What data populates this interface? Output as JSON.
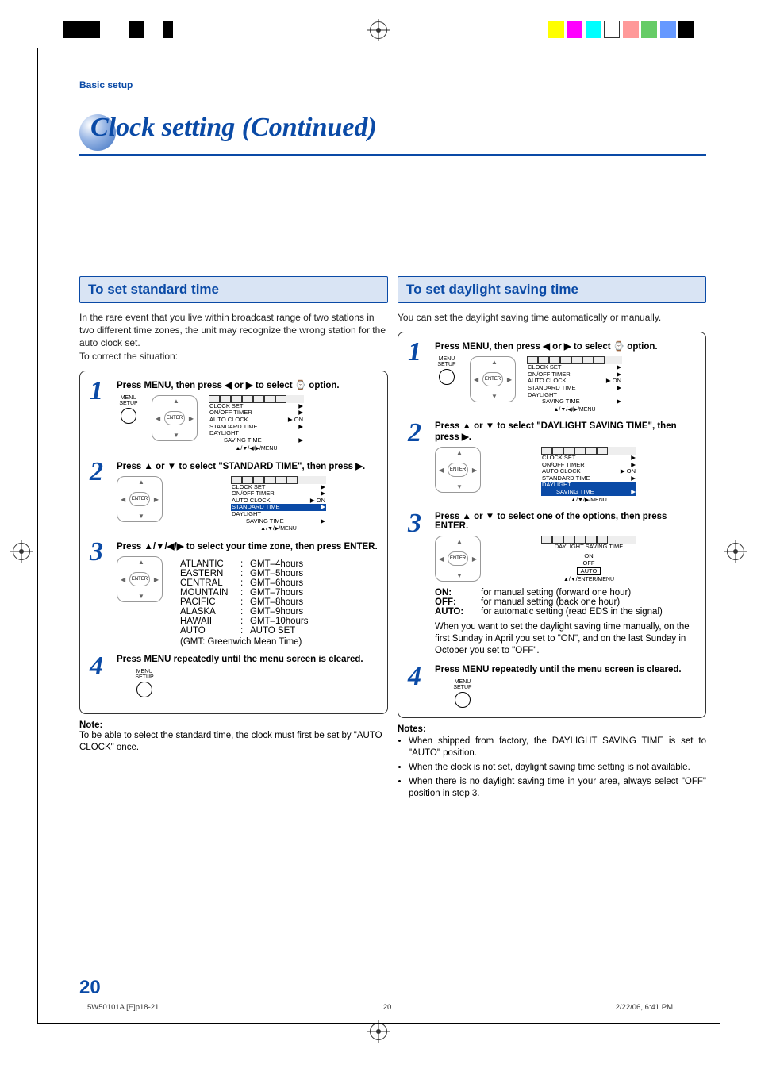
{
  "breadcrumb": "Basic setup",
  "title": "Clock setting (Continued)",
  "left": {
    "heading": "To set standard time",
    "intro": "In the rare event that you live within broadcast range of two stations in two different time zones, the unit may recognize the wrong station for the auto clock set.\nTo correct the situation:",
    "steps": {
      "s1": {
        "num": "1",
        "text_a": "Press MENU, then press ◀ or ▶ to select ",
        "text_b": " option."
      },
      "s2": {
        "num": "2",
        "text_a": "Press ▲ or ▼ to select \"STANDARD TIME\", then press ▶."
      },
      "s3": {
        "num": "3",
        "text_a": "Press ▲/▼/◀/▶ to select your time zone, then press ENTER."
      },
      "s4": {
        "num": "4",
        "text_a": "Press MENU repeatedly until the menu screen is cleared."
      }
    },
    "tz": {
      "rows": [
        {
          "k": "ATLANTIC",
          "v": "GMT–4hours"
        },
        {
          "k": "EASTERN",
          "v": "GMT–5hours"
        },
        {
          "k": "CENTRAL",
          "v": "GMT–6hours"
        },
        {
          "k": "MOUNTAIN",
          "v": "GMT–7hours"
        },
        {
          "k": "PACIFIC",
          "v": "GMT–8hours"
        },
        {
          "k": "ALASKA",
          "v": "GMT–9hours"
        },
        {
          "k": "HAWAII",
          "v": "GMT–10hours"
        },
        {
          "k": "AUTO",
          "v": "AUTO SET"
        }
      ],
      "foot": "(GMT: Greenwich Mean Time)"
    },
    "note_h": "Note:",
    "note_b": "To be able to select the standard time, the clock must first be set by \"AUTO CLOCK\" once."
  },
  "right": {
    "heading": "To set daylight saving time",
    "intro": "You can set the daylight saving time automatically or manually.",
    "steps": {
      "s1": {
        "num": "1",
        "text_a": "Press MENU, then press ◀ or ▶ to select ",
        "text_b": " option."
      },
      "s2": {
        "num": "2",
        "text_a": "Press ▲ or ▼ to select \"DAYLIGHT SAVING TIME\", then press ▶."
      },
      "s3": {
        "num": "3",
        "text_a": "Press ▲ or ▼ to select one of the options, then press ENTER."
      },
      "s4": {
        "num": "4",
        "text_a": "Press MENU repeatedly until the menu screen is cleared."
      }
    },
    "opts": {
      "on": {
        "k": "ON:",
        "v": "for manual setting (forward one hour)"
      },
      "off": {
        "k": "OFF:",
        "v": "for manual setting (back one hour)"
      },
      "auto": {
        "k": "AUTO:",
        "v": "for automatic setting (read EDS in the signal)"
      },
      "para": "When you want to set the daylight saving time manually, on the first Sunday in April you set to \"ON\", and on the last Sunday in October you set to \"OFF\"."
    },
    "notes_h": "Notes:",
    "notes": [
      "When shipped from factory, the DAYLIGHT SAVING TIME is set to \"AUTO\" position.",
      "When the clock is not set, daylight saving time setting is not available.",
      "When there is no daylight saving time in your area, always select \"OFF\" position in step 3."
    ]
  },
  "osd": {
    "cap1": "▲/▼/◀/▶/MENU",
    "cap2": "▲/▼/▶/MENU",
    "cap3": "▲/▼/ENTER/MENU",
    "lines": {
      "clock": "CLOCK  SET",
      "timer": "ON/OFF  TIMER",
      "auto": "AUTO  CLOCK",
      "std": "STANDARD  TIME",
      "dst": "DAYLIGHT",
      "dst2": "SAVING TIME",
      "dst_title": "DAYLIGHT  SAVING  TIME",
      "on_r": "▶ ON",
      "arr": "▶",
      "on": "ON",
      "off": "OFF",
      "autoo": "AUTO"
    }
  },
  "remote": {
    "menu": "MENU\nSETUP",
    "enter": "ENTER"
  },
  "page_number": "20",
  "footer": {
    "file": "5W50101A [E]p18-21",
    "page": "20",
    "date": "2/22/06, 6:41 PM"
  }
}
